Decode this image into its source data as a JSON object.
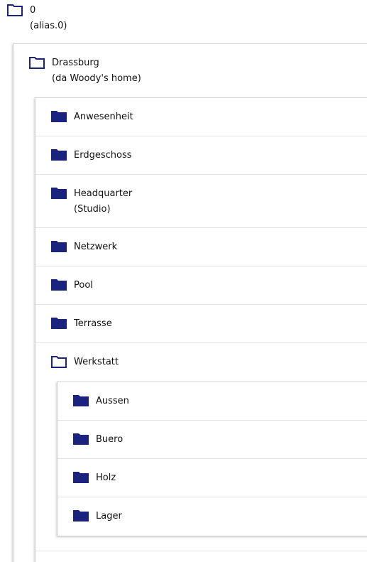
{
  "tree": {
    "root": {
      "name": "0",
      "subtitle": "(alias.0)",
      "icon": "folder-open-icon",
      "children": {
        "drassburg": {
          "name": "Drassburg",
          "subtitle": "(da Woody's home)",
          "icon": "folder-open-icon",
          "items": [
            {
              "name": "Anwesenheit",
              "icon": "folder-icon"
            },
            {
              "name": "Erdgeschoss",
              "icon": "folder-icon"
            },
            {
              "name": "Headquarter",
              "subtitle": "(Studio)",
              "icon": "folder-icon"
            },
            {
              "name": "Netzwerk",
              "icon": "folder-icon"
            },
            {
              "name": "Pool",
              "icon": "folder-icon"
            },
            {
              "name": "Terrasse",
              "icon": "folder-icon"
            },
            {
              "name": "Werkstatt",
              "icon": "folder-open-icon",
              "items": [
                {
                  "name": "Aussen",
                  "icon": "folder-icon"
                },
                {
                  "name": "Buero",
                  "icon": "folder-icon"
                },
                {
                  "name": "Holz",
                  "icon": "folder-icon"
                },
                {
                  "name": "Lager",
                  "icon": "folder-icon"
                }
              ]
            }
          ]
        }
      }
    }
  },
  "colors": {
    "folder": "#1a237e",
    "text": "#111111",
    "divider": "#e2e2e2"
  }
}
